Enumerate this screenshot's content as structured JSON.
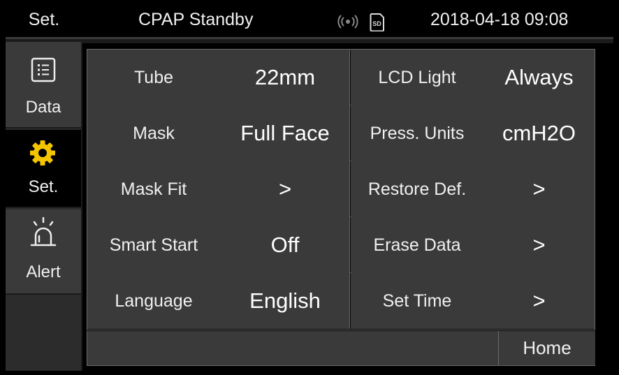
{
  "header": {
    "page": "Set.",
    "status": "CPAP Standby",
    "sd_label": "SD",
    "datetime": "2018-04-18 09:08"
  },
  "sidebar": {
    "items": [
      {
        "label": "Data",
        "icon": "list-icon"
      },
      {
        "label": "Set.",
        "icon": "gear-icon",
        "active": true
      },
      {
        "label": "Alert",
        "icon": "alarm-bell-icon"
      }
    ]
  },
  "settings": [
    {
      "left": {
        "name": "Tube",
        "value": "22mm"
      },
      "right": {
        "name": "LCD Light",
        "value": "Always"
      }
    },
    {
      "left": {
        "name": "Mask",
        "value": "Full Face"
      },
      "right": {
        "name": "Press. Units",
        "value": "cmH2O"
      }
    },
    {
      "left": {
        "name": "Mask Fit",
        "value": ">"
      },
      "right": {
        "name": "Restore Def.",
        "value": ">"
      }
    },
    {
      "left": {
        "name": "Smart Start",
        "value": "Off"
      },
      "right": {
        "name": "Erase Data",
        "value": ">"
      }
    },
    {
      "left": {
        "name": "Language",
        "value": "English"
      },
      "right": {
        "name": "Set Time",
        "value": ">"
      }
    }
  ],
  "footer": {
    "home_label": "Home"
  },
  "colors": {
    "accent": "#f5c400",
    "cell_bg": "#3a3a3a",
    "border": "#6a6a6a"
  }
}
